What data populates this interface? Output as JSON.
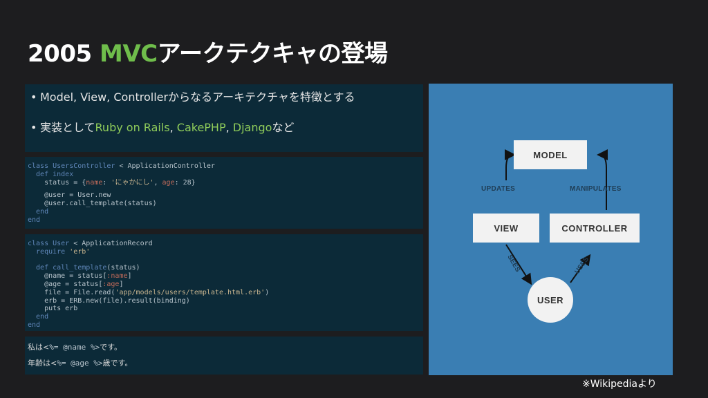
{
  "title": {
    "year": "2005",
    "mvc": "MVC",
    "rest": "アークテクキャの登場"
  },
  "bullets": [
    {
      "text": "Model, View, Controllerからなるアーキテクチャを特徴とする"
    },
    {
      "prefix": "実装として",
      "fw1": "Ruby on Rails",
      "sep1": ", ",
      "fw2": "CakePHP",
      "sep2": ", ",
      "fw3": "Django",
      "suffix": "など"
    }
  ],
  "diagram": {
    "nodes": {
      "model": "MODEL",
      "view": "VIEW",
      "controller": "CONTROLLER",
      "user": "USER"
    },
    "edges": {
      "updates": "UPDATES",
      "manipulates": "MANIPULATES",
      "sees": "SEES",
      "uses": "USES"
    }
  },
  "credit": "※Wikipediaより",
  "colors": {
    "background": "#1d1d1f",
    "panel": "#0c2a38",
    "accent": "#6fbd4b",
    "diagram": "#3a7eb3"
  }
}
